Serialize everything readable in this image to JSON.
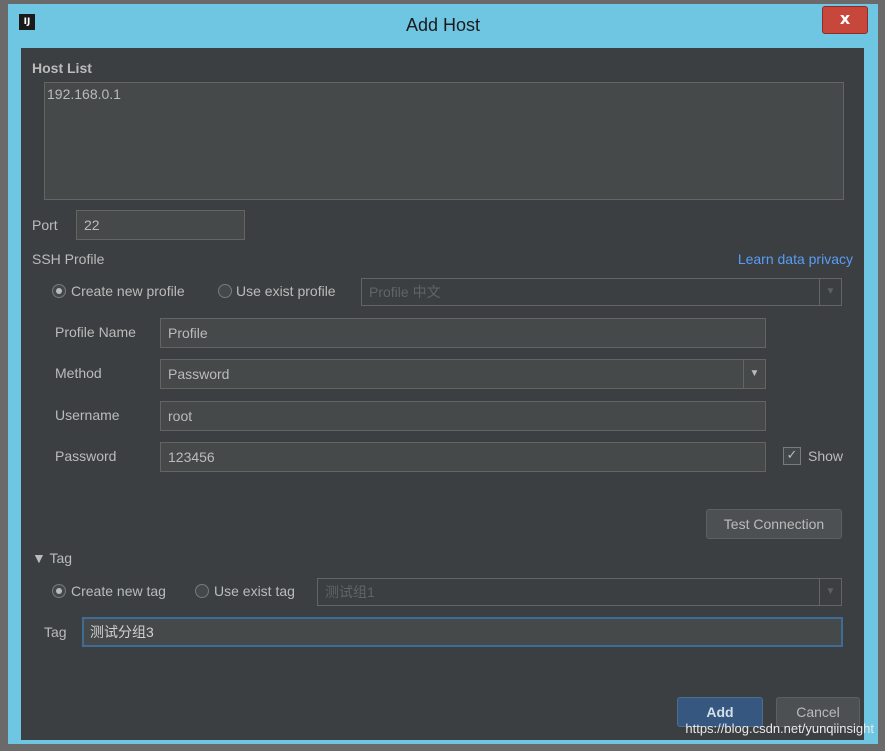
{
  "window": {
    "app_icon": "IJ",
    "title": "Add Host",
    "close_label": "x"
  },
  "host_list": {
    "label": "Host List",
    "items": [
      "192.168.0.1"
    ]
  },
  "port": {
    "label": "Port",
    "value": "22"
  },
  "ssh_profile": {
    "label": "SSH Profile",
    "privacy_link": "Learn data privacy",
    "create_new_label": "Create new profile",
    "use_exist_label": "Use exist profile",
    "exist_profile_value": "Profile 中文",
    "selected_mode": "create_new",
    "profile_name_label": "Profile Name",
    "profile_name_value": "Profile",
    "method_label": "Method",
    "method_value": "Password",
    "username_label": "Username",
    "username_value": "root",
    "password_label": "Password",
    "password_value": "123456",
    "show_label": "Show",
    "show_checked": true,
    "test_connection_label": "Test Connection"
  },
  "tag": {
    "section_label": "Tag",
    "create_new_label": "Create new tag",
    "use_exist_label": "Use exist tag",
    "exist_tag_value": "测试组1",
    "selected_mode": "create_new",
    "tag_label": "Tag",
    "tag_value": "测试分组3"
  },
  "footer": {
    "add_label": "Add",
    "cancel_label": "Cancel"
  },
  "watermark": "https://blog.csdn.net/yunqiinsight",
  "icons": {
    "collapse": "triangle-down-icon",
    "dropdown": "chevron-down-icon",
    "check": "checkmark-icon",
    "close": "close-icon",
    "app": "intellij-logo-icon"
  },
  "colors": {
    "window_frame": "#6ec6e3",
    "dialog_bg": "#3c3f41",
    "field_bg": "#45494a",
    "link": "#589df6",
    "primary_button": "#365880",
    "close_button": "#c7473c"
  }
}
